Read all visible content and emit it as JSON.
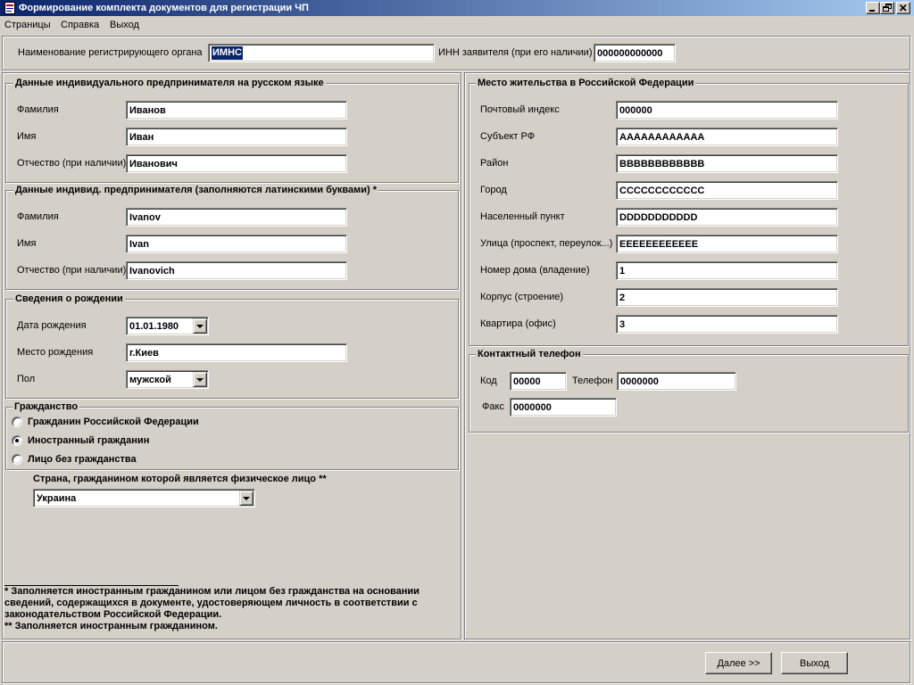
{
  "theme": {
    "titlebar_start": "#0a246a",
    "titlebar_end": "#a6caf0",
    "face": "#d4d0c8",
    "selection": "#0a246a"
  },
  "window": {
    "title": "Формирование комплекта документов для регистрации ЧП",
    "icons": {
      "app": "app-icon",
      "minimize": "minimize-icon",
      "restore": "restore-icon",
      "close": "close-icon",
      "dropdown": "chevron-down-icon"
    }
  },
  "menu": {
    "items": [
      "Страницы",
      "Справка",
      "Выход"
    ]
  },
  "header": {
    "org_label": "Наименование регистрирующего органа",
    "org_value": "ИМНС",
    "inn_label": "ИНН заявителя (при его наличии)",
    "inn_value": "000000000000"
  },
  "person_ru": {
    "title": "Данные индивидуального предпринимателя на русском языке",
    "fields": [
      {
        "label": "Фамилия",
        "value": "Иванов"
      },
      {
        "label": "Имя",
        "value": "Иван"
      },
      {
        "label": "Отчество (при наличии)",
        "value": "Иванович"
      }
    ]
  },
  "person_lat": {
    "title": "Данные индивид. предпринимателя (заполняются латинскими буквами) *",
    "fields": [
      {
        "label": "Фамилия",
        "value": "Ivanov"
      },
      {
        "label": "Имя",
        "value": "Ivan"
      },
      {
        "label": "Отчество (при наличии)",
        "value": "Ivanovich"
      }
    ]
  },
  "birth": {
    "title": "Сведения о рождении",
    "date_label": "Дата рождения",
    "date_value": "01.01.1980",
    "place_label": "Место рождения",
    "place_value": "г.Киев",
    "sex_label": "Пол",
    "sex_value": "мужской"
  },
  "citizenship": {
    "title": "Гражданство",
    "options": [
      {
        "label": "Гражданин Российской Федерации",
        "checked": false
      },
      {
        "label": "Иностранный гражданин",
        "checked": true
      },
      {
        "label": "Лицо без гражданства",
        "checked": false
      }
    ],
    "country_label": "Страна, гражданином которой является физическое лицо **",
    "country_value": "Украина"
  },
  "footnotes": {
    "lines": [
      "* Заполняется иностранным гражданином или лицом без гражданства на основании",
      "сведений, содержащихся в документе, удостоверяющем личность в соответствии с",
      "законодательством Российской Федерации.",
      "** Заполняется иностранным гражданином."
    ]
  },
  "address": {
    "title": "Место жительства в Российской Федерации",
    "fields": [
      {
        "label": "Почтовый индекс",
        "value": "000000"
      },
      {
        "label": "Субъект РФ",
        "value": "AAAAAAAAAAAA"
      },
      {
        "label": "Район",
        "value": "BBBBBBBBBBBB"
      },
      {
        "label": "Город",
        "value": "CCCCCCCCCCCC"
      },
      {
        "label": "Населенный пункт",
        "value": "DDDDDDDDDDD"
      },
      {
        "label": "Улица (проспект, переулок...)",
        "value": "EEEEEEEEEEEE"
      },
      {
        "label": "Номер дома (владение)",
        "value": "1"
      },
      {
        "label": "Корпус (строение)",
        "value": "2"
      },
      {
        "label": "Квартира (офис)",
        "value": "3"
      }
    ]
  },
  "phone": {
    "title": "Контактный телефон",
    "code_label": "Код",
    "code_value": "00000",
    "phone_label": "Телефон",
    "phone_value": "0000000",
    "fax_label": "Факс",
    "fax_value": "0000000"
  },
  "buttons": {
    "next": "Далее >>",
    "exit": "Выход"
  }
}
